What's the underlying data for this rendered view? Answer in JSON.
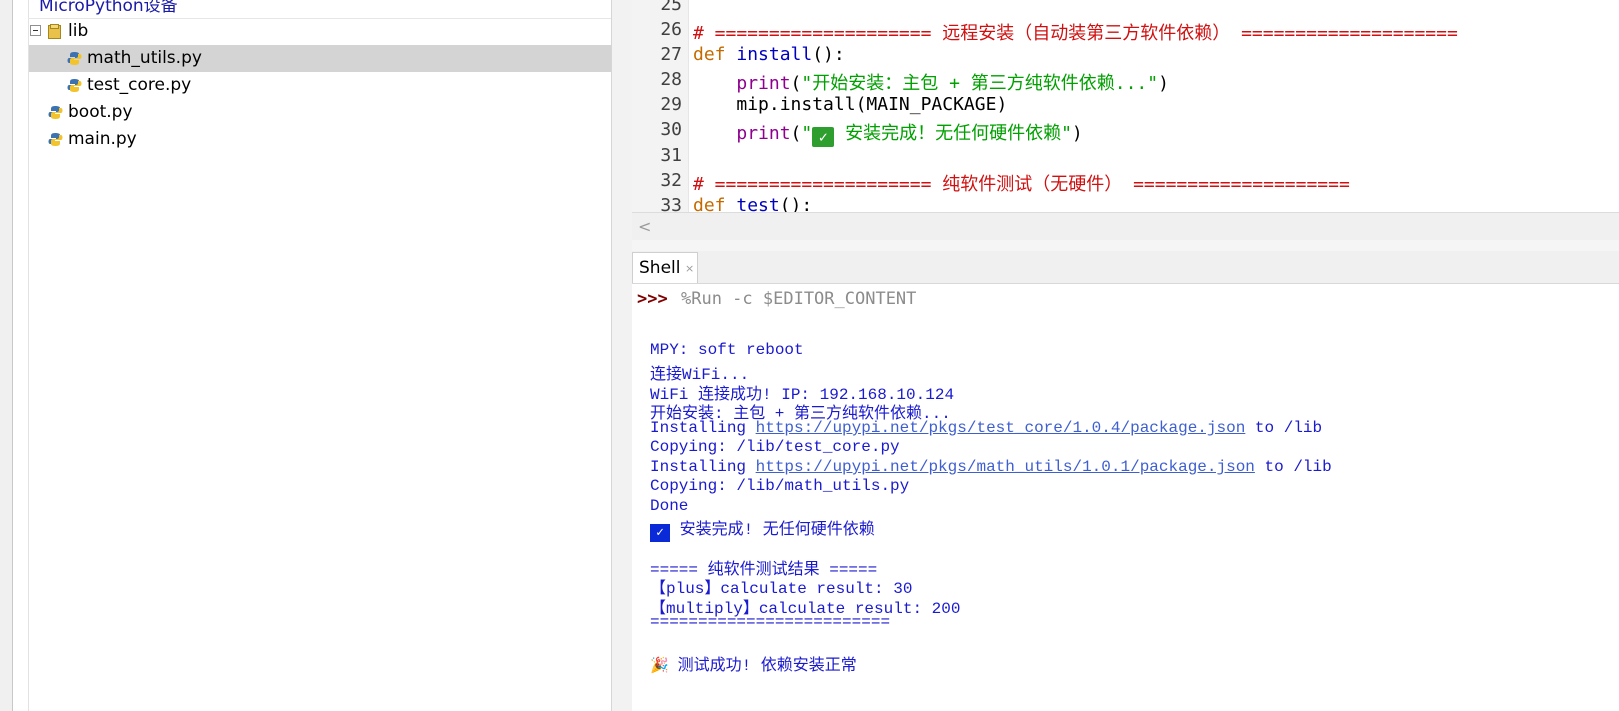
{
  "files": {
    "panel_title": "MicroPython设备",
    "tree": [
      {
        "name": "lib",
        "type": "folder"
      },
      {
        "name": "math_utils.py",
        "type": "python",
        "selected": true
      },
      {
        "name": "test_core.py",
        "type": "python"
      },
      {
        "name": "boot.py",
        "type": "python"
      },
      {
        "name": "main.py",
        "type": "python"
      }
    ]
  },
  "editor": {
    "line_numbers": [
      "25",
      "26",
      "27",
      "28",
      "29",
      "30",
      "31",
      "32",
      "33"
    ],
    "l26_comment": "# ==================== 远程安装（自动装第三方软件依赖） ====================",
    "l27_kw": "def",
    "l27_fn": "install",
    "l27_rest": "():",
    "l28_fn": "print",
    "l28_str": "\"开始安装：主包 + 第三方纯软件依赖...\"",
    "l29_code": "mip.install(MAIN_PACKAGE)",
    "l30_fn": "print",
    "l30_str_open": "\"",
    "l30_check": "✓",
    "l30_str_rest": " 安装完成！无任何硬件依赖\"",
    "l32_comment": "# ==================== 纯软件测试（无硬件） ====================",
    "l33_kw": "def",
    "l33_fn": "test",
    "l33_rest": "():"
  },
  "shell": {
    "tab_label": "Shell",
    "tab_close": "×",
    "prompt": ">>>",
    "command": "%Run -c $EDITOR_CONTENT",
    "output": {
      "soft_reboot": "MPY: soft reboot",
      "connecting": "连接WiFi...",
      "connected": "WiFi 连接成功! IP: 192.168.10.124",
      "start": "开始安装: 主包 + 第三方纯软件依赖...",
      "install1_prefix": "Installing ",
      "install1_url": "https://upypi.net/pkgs/test_core/1.0.4/package.json",
      "install1_suffix": " to /lib",
      "copy1": "Copying: /lib/test_core.py",
      "install2_prefix": "Installing ",
      "install2_url": "https://upypi.net/pkgs/math_utils/1.0.1/package.json",
      "install2_suffix": " to /lib",
      "copy2": "Copying: /lib/math_utils.py",
      "done": "Done",
      "check": "✓",
      "install_complete": " 安装完成! 无任何硬件依赖",
      "test_header": "===== 纯软件测试结果 =====",
      "plus_result": "【plus】calculate result: 30",
      "multiply_result": "【multiply】calculate result: 200",
      "rule": "=========================",
      "party": "🎉",
      "test_success": " 测试成功! 依赖安装正常"
    }
  },
  "colors": {
    "comment": "#d01010",
    "keyword": "#c46a00",
    "function": "#0000c0",
    "builtin": "#900090",
    "string": "#00a000",
    "shell_output": "#1a1ad0",
    "prompt": "#800000"
  }
}
